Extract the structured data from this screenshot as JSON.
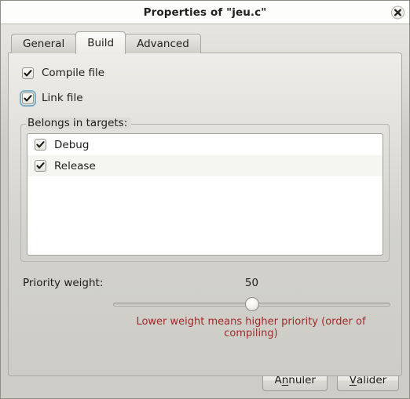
{
  "window": {
    "title": "Properties of \"jeu.c\"",
    "close_icon": "close-icon"
  },
  "tabs": [
    {
      "label": "General",
      "active": false
    },
    {
      "label": "Build",
      "active": true
    },
    {
      "label": "Advanced",
      "active": false
    }
  ],
  "build_tab": {
    "checkboxes": [
      {
        "label": "Compile file",
        "checked": true,
        "focused": false
      },
      {
        "label": "Link file",
        "checked": true,
        "focused": true
      }
    ],
    "targets_group": {
      "title": "Belongs in targets:",
      "items": [
        {
          "label": "Debug",
          "checked": true
        },
        {
          "label": "Release",
          "checked": true
        }
      ]
    },
    "priority": {
      "label": "Priority weight:",
      "value": "50",
      "min": 0,
      "max": 100,
      "hint": "Lower weight means higher priority (order of compiling)",
      "hint_color": "#9f2a2a"
    }
  },
  "footer": {
    "cancel": {
      "pre": "A",
      "mnemonic": "n",
      "post": "nuler"
    },
    "ok": {
      "pre": "",
      "mnemonic": "V",
      "post": "alider"
    }
  }
}
